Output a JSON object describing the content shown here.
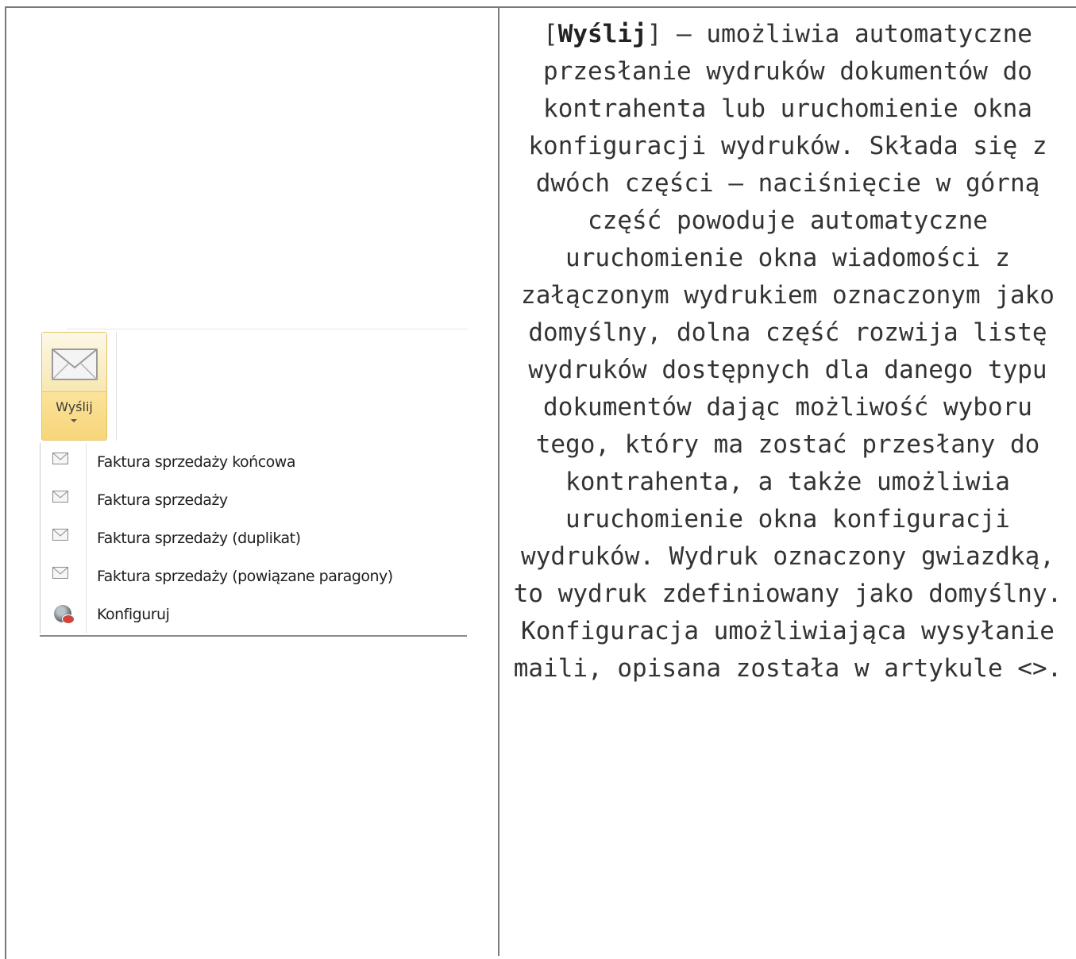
{
  "ribbon": {
    "send_button": {
      "label": "Wyślij",
      "icon": "envelope-icon",
      "accent_border": "#e5c365",
      "accent_fill": "#f7d57a"
    }
  },
  "menu": {
    "items": [
      {
        "label": "Faktura sprzedaży końcowa",
        "icon": "envelope-icon"
      },
      {
        "label": "Faktura sprzedaży",
        "icon": "envelope-icon"
      },
      {
        "label": "Faktura sprzedaży (duplikat)",
        "icon": "envelope-icon"
      },
      {
        "label": "Faktura sprzedaży (powiązane paragony)",
        "icon": "envelope-icon"
      },
      {
        "label": "Konfiguruj",
        "icon": "configure-gear-icon"
      }
    ]
  },
  "description": {
    "open_bracket": "[",
    "keyword": "Wyślij",
    "text": "] – umożliwia automatyczne przesłanie wydruków dokumentów do kontrahenta lub uruchomienie okna konfiguracji wydruków. Składa się z dwóch części – naciśnięcie w górną część powoduje automatyczne uruchomienie okna wiadomości z załączonym wydrukiem oznaczonym jako domyślny, dolna część rozwija listę wydruków dostępnych dla danego typu dokumentów dając możliwość wyboru tego, który ma zostać przesłany do kontrahenta, a także umożliwia uruchomienie okna konfiguracji wydruków. Wydruk oznaczony gwiazdką, to wydruk zdefiniowany jako domyślny. Konfiguracja umożliwiająca wysyłanie maili, opisana została w artykule <>."
  }
}
